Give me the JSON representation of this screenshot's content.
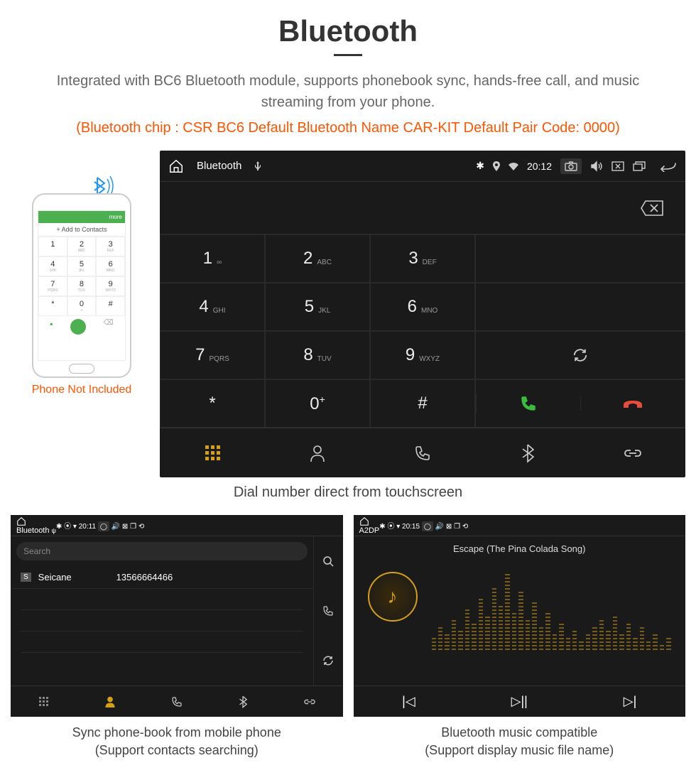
{
  "header": {
    "title": "Bluetooth",
    "description": "Integrated with BC6 Bluetooth module, supports phonebook sync, hands-free call, and music streaming from your phone.",
    "specs": "(Bluetooth chip : CSR BC6    Default Bluetooth Name CAR-KIT    Default Pair Code: 0000)"
  },
  "phone": {
    "topbar": "more",
    "add": "+ Add to Contacts",
    "label": "Phone Not Included",
    "keys": [
      {
        "n": "1",
        "s": ""
      },
      {
        "n": "2",
        "s": "ABC"
      },
      {
        "n": "3",
        "s": "DEF"
      },
      {
        "n": "4",
        "s": "GHI"
      },
      {
        "n": "5",
        "s": "JKL"
      },
      {
        "n": "6",
        "s": "MNO"
      },
      {
        "n": "7",
        "s": "PQRS"
      },
      {
        "n": "8",
        "s": "TUV"
      },
      {
        "n": "9",
        "s": "WXYZ"
      },
      {
        "n": "*",
        "s": ""
      },
      {
        "n": "0",
        "s": "+"
      },
      {
        "n": "#",
        "s": ""
      }
    ]
  },
  "device1": {
    "title": "Bluetooth",
    "time": "20:12",
    "keys": [
      {
        "n": "1",
        "s": "∞"
      },
      {
        "n": "2",
        "s": "ABC"
      },
      {
        "n": "3",
        "s": "DEF"
      },
      {
        "n": "4",
        "s": "GHI"
      },
      {
        "n": "5",
        "s": "JKL"
      },
      {
        "n": "6",
        "s": "MNO"
      },
      {
        "n": "7",
        "s": "PQRS"
      },
      {
        "n": "8",
        "s": "TUV"
      },
      {
        "n": "9",
        "s": "WXYZ"
      },
      {
        "n": "*",
        "s": ""
      },
      {
        "n": "0",
        "s": "+",
        "sup": true
      },
      {
        "n": "#",
        "s": ""
      }
    ],
    "caption": "Dial number direct from touchscreen"
  },
  "device2": {
    "title": "Bluetooth",
    "time": "20:11",
    "search": "Search",
    "contact_badge": "S",
    "contact_name": "Seicane",
    "contact_number": "13566664466",
    "caption1": "Sync phone-book from mobile phone",
    "caption2": "(Support contacts searching)"
  },
  "device3": {
    "title": "A2DP",
    "time": "20:15",
    "song": "Escape (The Pina Colada Song)",
    "caption1": "Bluetooth music compatible",
    "caption2": "(Support display music file name)"
  }
}
